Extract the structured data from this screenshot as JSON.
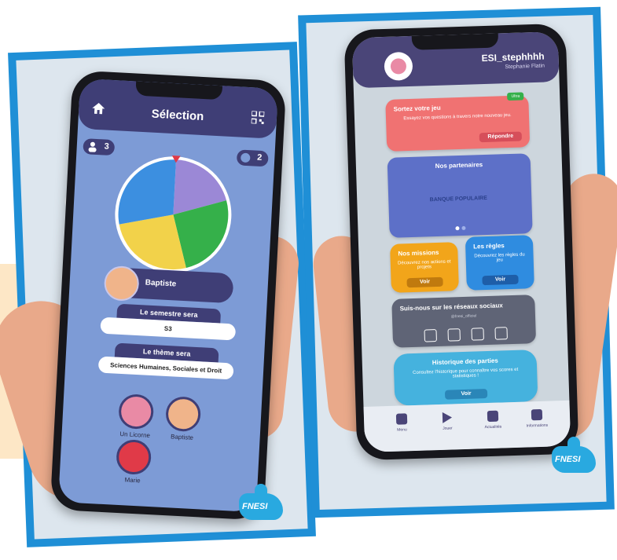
{
  "left_app": {
    "title": "Sélection",
    "players_count": "3",
    "coins_count": "2",
    "wheel_colors": [
      "#9b88d6",
      "#35b04a",
      "#f2d24a",
      "#3c8fe0"
    ],
    "selected_player": "Baptiste",
    "semester": {
      "label": "Le semestre sera",
      "value": "S3"
    },
    "theme": {
      "label": "Le thème sera",
      "value": "Sciences Humaines, Sociales et Droit"
    },
    "players": [
      {
        "name": "Un Licorne",
        "color": "#e98aa5"
      },
      {
        "name": "Baptiste",
        "color": "#f0b48a"
      },
      {
        "name": "Marie",
        "color": "#e03a48"
      }
    ],
    "icons": {
      "home": "home-icon",
      "qr": "qr-code-icon",
      "players": "users-icon"
    },
    "colors": {
      "header": "#3f3e76",
      "screen": "#7d9bd6"
    }
  },
  "right_app": {
    "username": "ESI_stephhhh",
    "real_name": "Stephanie Flatin",
    "challenge": {
      "title": "Sortez votre jeu",
      "tag": "Ultra",
      "text": "Essayez vos questions à travers notre nouveau jeu.",
      "button": "Répondre"
    },
    "partners": {
      "title": "Nos partenaires",
      "partner_name": "BANQUE POPULAIRE"
    },
    "missions": {
      "title": "Nos missions",
      "text": "Découvrez nos actions et projets",
      "button": "Voir"
    },
    "rules": {
      "title": "Les règles",
      "text": "Découvrez les règles du jeu",
      "button": "Voir"
    },
    "social": {
      "title": "Suis-nous sur les réseaux sociaux",
      "subtitle": "@fnesi_officiel"
    },
    "history": {
      "title": "Historique des parties",
      "text": "Consultez l'historique pour connaître vos scores et statistiques !",
      "button": "Voir"
    },
    "nav": [
      "Menu",
      "Jouer",
      "Actualités",
      "Informations"
    ],
    "colors": {
      "header": "#4a4578",
      "challenge": "#f07272",
      "partners": "#5d70c8",
      "missions": "#f2a51a",
      "rules": "#2f8ce0",
      "social": "#5f6476",
      "history": "#45b2de"
    }
  },
  "brand": {
    "fnesi": "FNESI"
  }
}
